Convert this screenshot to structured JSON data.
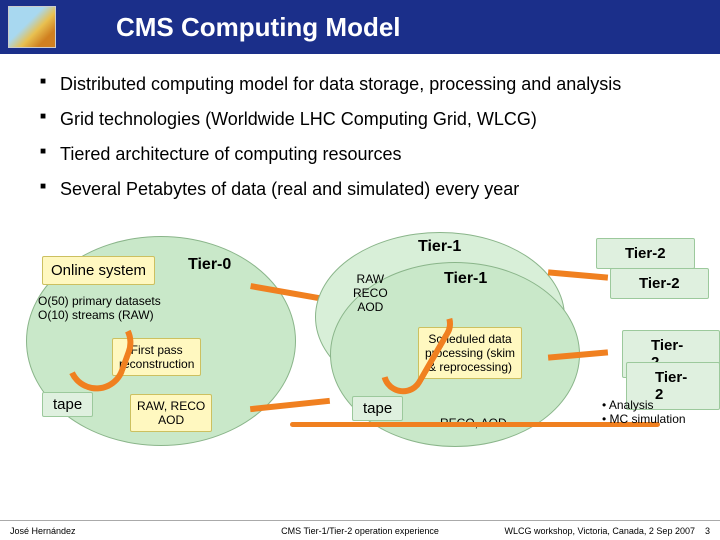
{
  "title": "CMS Computing Model",
  "bullets": [
    "Distributed computing model for data storage, processing and analysis",
    "Grid technologies (Worldwide LHC Computing Grid, WLCG)",
    "Tiered architecture of computing resources",
    "Several Petabytes of data (real and simulated) every year"
  ],
  "diagram": {
    "online_system": "Online system",
    "tier0": "Tier-0",
    "datasets_note": "O(50) primary datasets\nO(10) streams (RAW)",
    "first_pass": "First pass\nreconstruction",
    "tape1": "tape",
    "raw_reco_aod_box": "RAW, RECO\nAOD",
    "raw_reco_aod_col": "RAW\nRECO\nAOD",
    "tier1_top": "Tier-1",
    "tier1_mid": "Tier-1",
    "scheduled": "Scheduled data\nprocessing (skim\n& reprocessing)",
    "tape2": "tape",
    "reco_aod": "RECO, AOD",
    "tier2a": "Tier-2",
    "tier2b": "Tier-2",
    "tier2c": "Tier-2",
    "tier2d": "Tier-2",
    "analysis": "• Analysis\n• MC simulation"
  },
  "footer": {
    "left": "José Hernández",
    "center": "CMS Tier-1/Tier-2 operation experience",
    "right": "WLCG workshop, Victoria, Canada, 2 Sep 2007",
    "page": "3"
  }
}
